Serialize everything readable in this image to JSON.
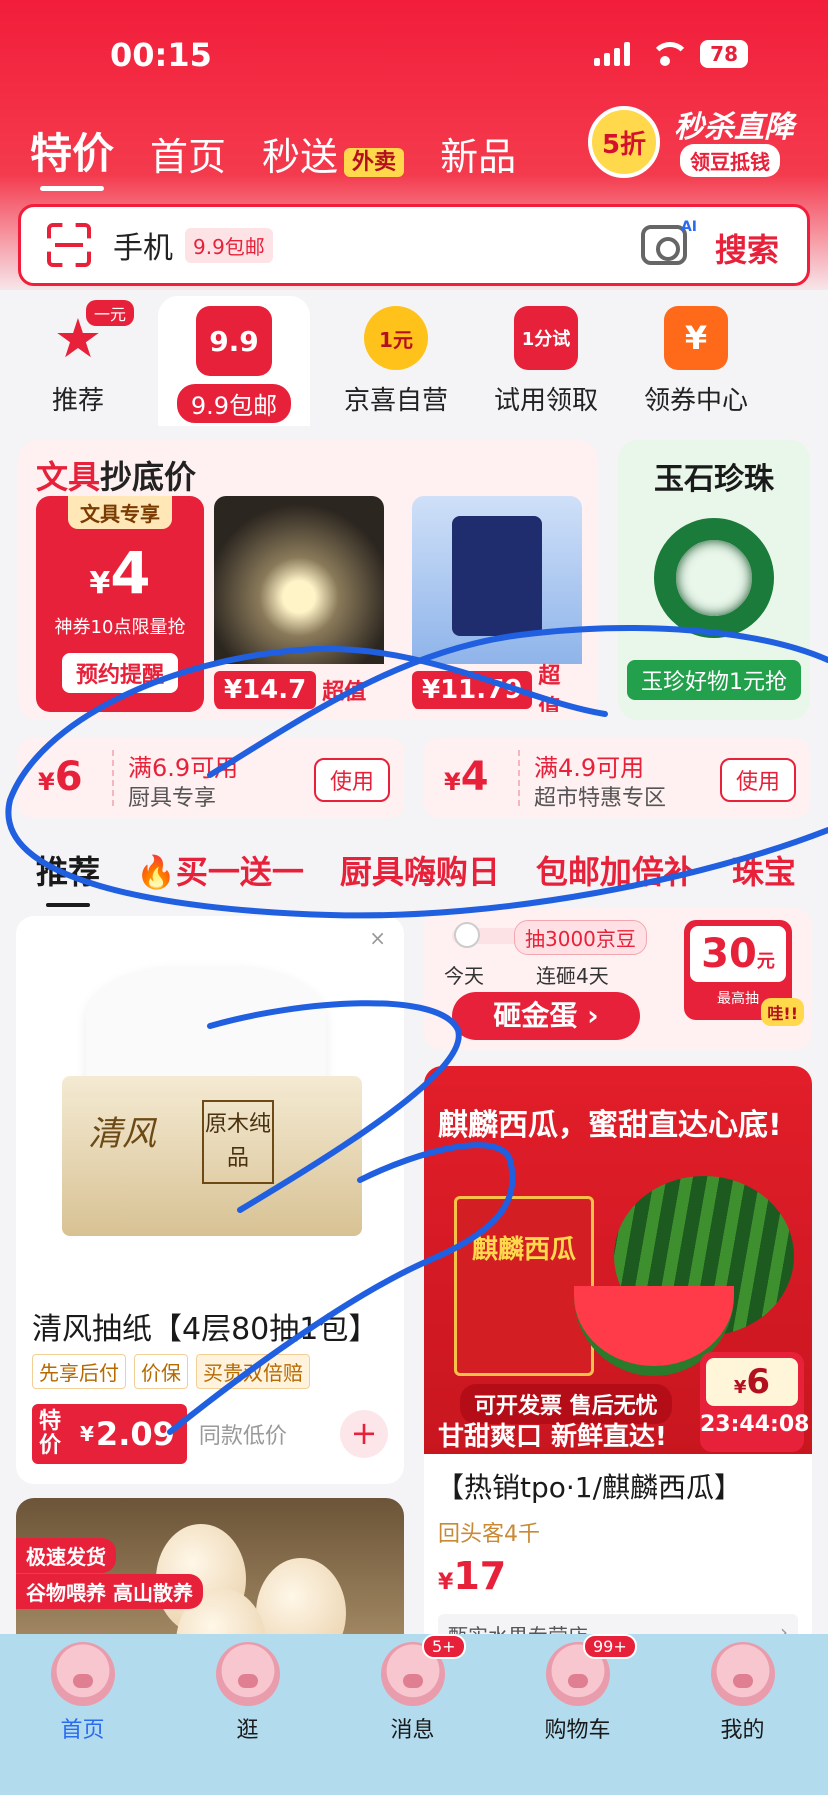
{
  "status_bar": {
    "time": "00:15",
    "battery": "78"
  },
  "top_tabs": [
    {
      "label": "特价"
    },
    {
      "label": "首页"
    },
    {
      "label": "秒送",
      "badge": "外卖"
    },
    {
      "label": "新品"
    }
  ],
  "promo": {
    "badge": "5折",
    "title": "秒杀直降",
    "subtitle": "领豆抵钱"
  },
  "search": {
    "query": "手机",
    "tag": "9.9包邮",
    "camera_badge": "AI",
    "button": "搜索"
  },
  "categories": [
    {
      "label": "推荐",
      "badge": "一元",
      "icon": "star-check-icon"
    },
    {
      "label": "9.9包邮",
      "icon_text": "9.9"
    },
    {
      "label": "京喜自营",
      "icon_text": "1元"
    },
    {
      "label": "试用领取",
      "icon_text": "1分试"
    },
    {
      "label": "领券中心",
      "icon_text": "¥"
    }
  ],
  "wenju": {
    "title_red": "文具",
    "title_rest": "抄底价",
    "main_tag": "文具专享",
    "main_currency": "¥",
    "main_price": "4",
    "main_desc": "神券10点限量抢",
    "main_button": "预约提醒",
    "items": [
      {
        "currency": "¥",
        "price": "14.7",
        "label": "超值"
      },
      {
        "currency": "¥",
        "price": "11.79",
        "label": "超值"
      }
    ]
  },
  "jade": {
    "title": "玉石珍珠",
    "pill": "玉珍好物1元抢"
  },
  "coupons": [
    {
      "currency": "¥",
      "amount": "6",
      "condition": "满6.9可用",
      "scope": "厨具专享",
      "button": "使用"
    },
    {
      "currency": "¥",
      "amount": "4",
      "condition": "满4.9可用",
      "scope": "超市特惠专区",
      "button": "使用"
    }
  ],
  "feed_tabs": [
    "推荐",
    "🔥买一送一",
    "厨具嗨购日",
    "包邮加倍补",
    "珠宝"
  ],
  "product_left": {
    "close": "×",
    "brand": "清风",
    "box_label": "原木纯品",
    "title": "清风抽纸【4层80抽1包】",
    "tags": [
      "先享后付",
      "价保",
      "买贵双倍赔"
    ],
    "te_label": "特价",
    "currency": "¥",
    "price": "2.09",
    "note": "同款低价",
    "plus": "+"
  },
  "egg_card": {
    "tags": [
      "极速发货",
      "谷物喂养 高山散养"
    ]
  },
  "game": {
    "reward": "抽3000京豆",
    "today": "今天",
    "days": "连砸4天",
    "button": "砸金蛋 ›",
    "prize_amount": "30",
    "prize_unit": "元",
    "prize_label": "最高抽",
    "prize_badge": "哇!!"
  },
  "melon": {
    "headline": "麒麟西瓜，蜜甜直达心底!",
    "box_text": "麒麟西瓜",
    "banner": "可开发票 售后无忧",
    "slogan": "甘甜爽口 新鲜直达!",
    "timer_currency": "¥",
    "timer_price": "6",
    "timer": "23:44:08",
    "title": "【热销tpo·1/麒麟西瓜】",
    "repeat": "回头客4千",
    "currency": "¥",
    "price": "17",
    "shop": "甄实水果专营店",
    "shop_chev": "›"
  },
  "bottom_nav": [
    {
      "label": "首页"
    },
    {
      "label": "逛"
    },
    {
      "label": "消息",
      "badge": "5+"
    },
    {
      "label": "购物车",
      "badge": "99+"
    },
    {
      "label": "我的"
    }
  ],
  "colors": {
    "brand_red": "#e8213a",
    "nav_bg": "#b2dbee",
    "scribble_blue": "#1f5fe0"
  }
}
